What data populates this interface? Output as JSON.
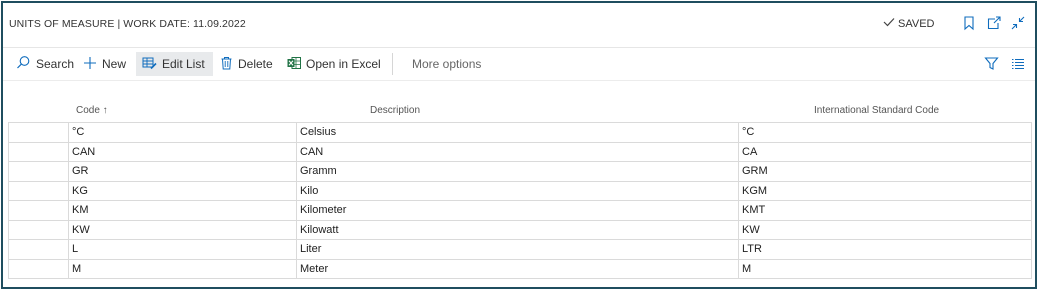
{
  "title": "UNITS OF MEASURE | WORK DATE: 11.09.2022",
  "status": {
    "saved_label": "SAVED"
  },
  "header_icons": [
    "bookmark-icon",
    "open-new-window-icon",
    "collapse-icon"
  ],
  "actions": {
    "search": "Search",
    "new": "New",
    "edit_list": "Edit List",
    "delete": "Delete",
    "open_in_excel": "Open in Excel",
    "more_options": "More options"
  },
  "columns": {
    "code": "Code ↑",
    "description": "Description",
    "intl_code": "International Standard Code"
  },
  "rows": [
    {
      "code": "°C",
      "description": "Celsius",
      "intl": "°C"
    },
    {
      "code": "CAN",
      "description": "CAN",
      "intl": "CA"
    },
    {
      "code": "GR",
      "description": "Gramm",
      "intl": "GRM"
    },
    {
      "code": "KG",
      "description": "Kilo",
      "intl": "KGM"
    },
    {
      "code": "KM",
      "description": "Kilometer",
      "intl": "KMT"
    },
    {
      "code": "KW",
      "description": "Kilowatt",
      "intl": "KW"
    },
    {
      "code": "L",
      "description": "Liter",
      "intl": "LTR"
    },
    {
      "code": "M",
      "description": "Meter",
      "intl": "M"
    }
  ],
  "colors": {
    "accent": "#1f4e5f",
    "excel_green": "#217346",
    "link_blue": "#0f6cbd"
  }
}
